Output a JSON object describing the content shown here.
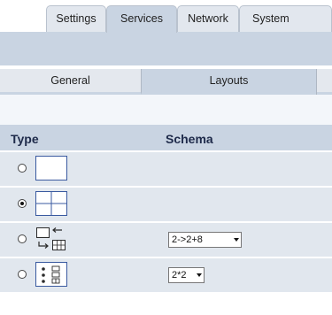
{
  "top_tabs": [
    {
      "label": "Settings",
      "active": false
    },
    {
      "label": "Services",
      "active": true
    },
    {
      "label": "Network",
      "active": false
    },
    {
      "label": "System",
      "active": false
    }
  ],
  "sub_tabs": [
    {
      "label": "General",
      "active": true
    },
    {
      "label": "Layouts",
      "active": false
    }
  ],
  "table": {
    "headers": {
      "type": "Type",
      "schema": "Schema"
    },
    "rows": [
      {
        "layout_icon": "single-pane-icon",
        "selected": false,
        "schema": ""
      },
      {
        "layout_icon": "quad-pane-icon",
        "selected": true,
        "schema": ""
      },
      {
        "layout_icon": "split-2-to-2-8-icon",
        "selected": false,
        "schema": "2->2+8"
      },
      {
        "layout_icon": "dual-list-icon",
        "selected": false,
        "schema": "2*2"
      }
    ]
  },
  "colors": {
    "accent_bar": "#c9d4e2",
    "row_bg": "#e1e7ee",
    "header_text": "#1e2a4a"
  }
}
